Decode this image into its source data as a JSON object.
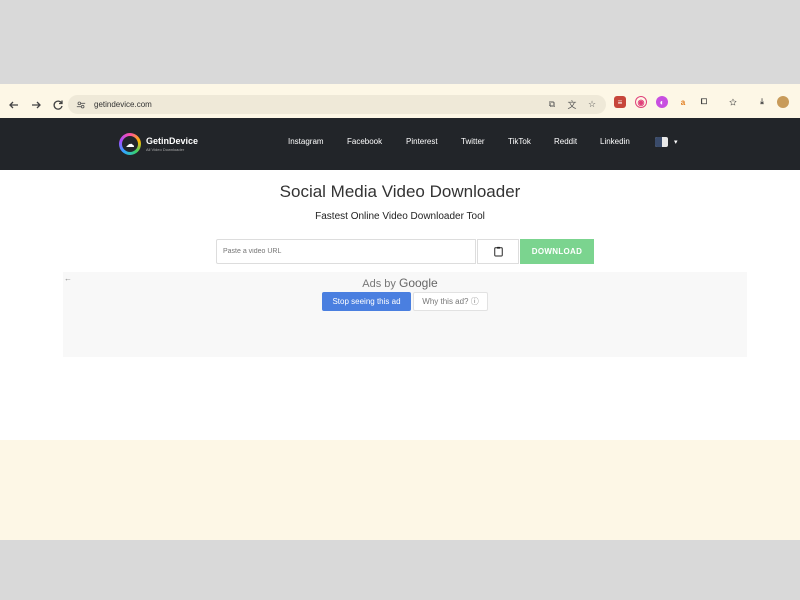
{
  "browser": {
    "url": "getindevice.com"
  },
  "site": {
    "logo_title": "GetinDevice",
    "logo_subtitle": "All Video Downloader",
    "nav": [
      "Instagram",
      "Facebook",
      "Pinterest",
      "Twitter",
      "TikTok",
      "Reddit",
      "Linkedin"
    ]
  },
  "main": {
    "title": "Social Media Video Downloader",
    "subtitle": "Fastest Online Video Downloader Tool",
    "input_placeholder": "Paste a video URL",
    "download_label": "DOWNLOAD"
  },
  "ad": {
    "ads_by": "Ads by",
    "google": "Google",
    "stop_label": "Stop seeing this ad",
    "why_label": "Why this ad? ⓘ"
  },
  "colors": {
    "header_bg": "#222529",
    "download_btn": "#7bd48f",
    "stop_btn": "#4a7fe0"
  }
}
